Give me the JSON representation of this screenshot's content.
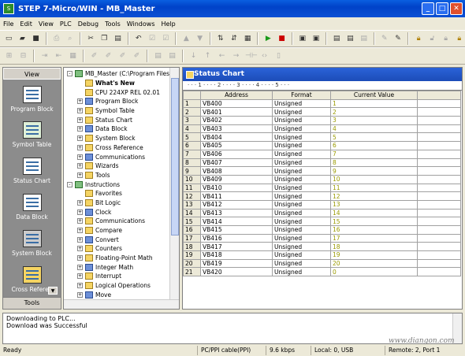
{
  "window": {
    "title": "STEP 7-Micro/WIN - MB_Master",
    "app_icon": "step7-icon"
  },
  "menu": [
    "File",
    "Edit",
    "View",
    "PLC",
    "Debug",
    "Tools",
    "Windows",
    "Help"
  ],
  "nav": {
    "header": "View",
    "items": [
      {
        "label": "Program Block",
        "icon": "program-block-icon"
      },
      {
        "label": "Symbol Table",
        "icon": "symbol-table-icon"
      },
      {
        "label": "Status Chart",
        "icon": "status-chart-icon"
      },
      {
        "label": "Data Block",
        "icon": "data-block-icon"
      },
      {
        "label": "System Block",
        "icon": "system-block-icon"
      },
      {
        "label": "Cross Referen",
        "icon": "cross-reference-icon"
      }
    ],
    "footer": "Tools"
  },
  "tree": [
    {
      "text": "MB_Master (C:\\Program Files\\",
      "level": 0,
      "expand": "-"
    },
    {
      "text": "What's New",
      "level": 1,
      "bold": true
    },
    {
      "text": "CPU 224XP REL 02.01",
      "level": 1
    },
    {
      "text": "Program Block",
      "level": 1,
      "expand": "+"
    },
    {
      "text": "Symbol Table",
      "level": 1,
      "expand": "+"
    },
    {
      "text": "Status Chart",
      "level": 1,
      "expand": "+"
    },
    {
      "text": "Data Block",
      "level": 1,
      "expand": "+"
    },
    {
      "text": "System Block",
      "level": 1,
      "expand": "+"
    },
    {
      "text": "Cross Reference",
      "level": 1,
      "expand": "+"
    },
    {
      "text": "Communications",
      "level": 1,
      "expand": "+"
    },
    {
      "text": "Wizards",
      "level": 1,
      "expand": "+"
    },
    {
      "text": "Tools",
      "level": 1,
      "expand": "+"
    },
    {
      "text": "Instructions",
      "level": 0,
      "expand": "-"
    },
    {
      "text": "Favorites",
      "level": 1
    },
    {
      "text": "Bit Logic",
      "level": 1,
      "expand": "+"
    },
    {
      "text": "Clock",
      "level": 1,
      "expand": "+"
    },
    {
      "text": "Communications",
      "level": 1,
      "expand": "+"
    },
    {
      "text": "Compare",
      "level": 1,
      "expand": "+"
    },
    {
      "text": "Convert",
      "level": 1,
      "expand": "+"
    },
    {
      "text": "Counters",
      "level": 1,
      "expand": "+"
    },
    {
      "text": "Floating-Point Math",
      "level": 1,
      "expand": "+"
    },
    {
      "text": "Integer Math",
      "level": 1,
      "expand": "+"
    },
    {
      "text": "Interrupt",
      "level": 1,
      "expand": "+"
    },
    {
      "text": "Logical Operations",
      "level": 1,
      "expand": "+"
    },
    {
      "text": "Move",
      "level": 1,
      "expand": "+"
    }
  ],
  "status_chart": {
    "title": "Status Chart",
    "ruler": "· · · 1 · · · · 2 · · · · 3 · · · · 4 · · · · 5 · · ·",
    "columns": [
      "Address",
      "Format",
      "Current Value"
    ],
    "rows": [
      [
        "1",
        "VB400",
        "Unsigned",
        "1"
      ],
      [
        "2",
        "VB401",
        "Unsigned",
        "2"
      ],
      [
        "3",
        "VB402",
        "Unsigned",
        "3"
      ],
      [
        "4",
        "VB403",
        "Unsigned",
        "4"
      ],
      [
        "5",
        "VB404",
        "Unsigned",
        "5"
      ],
      [
        "6",
        "VB405",
        "Unsigned",
        "6"
      ],
      [
        "7",
        "VB406",
        "Unsigned",
        "7"
      ],
      [
        "8",
        "VB407",
        "Unsigned",
        "8"
      ],
      [
        "9",
        "VB408",
        "Unsigned",
        "9"
      ],
      [
        "10",
        "VB409",
        "Unsigned",
        "10"
      ],
      [
        "11",
        "VB410",
        "Unsigned",
        "11"
      ],
      [
        "12",
        "VB411",
        "Unsigned",
        "12"
      ],
      [
        "13",
        "VB412",
        "Unsigned",
        "13"
      ],
      [
        "14",
        "VB413",
        "Unsigned",
        "14"
      ],
      [
        "15",
        "VB414",
        "Unsigned",
        "15"
      ],
      [
        "16",
        "VB415",
        "Unsigned",
        "16"
      ],
      [
        "17",
        "VB416",
        "Unsigned",
        "17"
      ],
      [
        "18",
        "VB417",
        "Unsigned",
        "18"
      ],
      [
        "19",
        "VB418",
        "Unsigned",
        "19"
      ],
      [
        "20",
        "VB419",
        "Unsigned",
        "20"
      ],
      [
        "21",
        "VB420",
        "Unsigned",
        "0"
      ]
    ]
  },
  "log": [
    "Downloading to PLC...",
    "Download was Successful"
  ],
  "statusbar": [
    "Ready",
    "PC/PPI cable(PPI)",
    "9.6 kbps",
    "Local: 0, USB",
    "Remote: 2, Port 1"
  ],
  "watermark": "www.diangon.com"
}
